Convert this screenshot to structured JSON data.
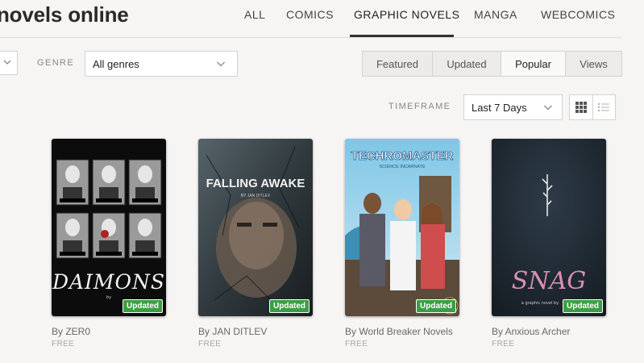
{
  "header": {
    "title": "novels online",
    "tabs": [
      {
        "label": "ALL"
      },
      {
        "label": "COMICS"
      },
      {
        "label": "GRAPHIC NOVELS"
      },
      {
        "label": "MANGA"
      },
      {
        "label": "WEBCOMICS"
      }
    ],
    "active_tab": "GRAPHIC NOVELS"
  },
  "filters": {
    "genre_label": "GENRE",
    "genre_value": "All genres",
    "sort_options": [
      {
        "label": "Featured"
      },
      {
        "label": "Updated"
      },
      {
        "label": "Popular"
      },
      {
        "label": "Views"
      }
    ],
    "active_sort": "Popular",
    "timeframe_label": "TIMEFRAME",
    "timeframe_value": "Last 7 Days",
    "view_modes": [
      "grid-icon",
      "list-icon"
    ],
    "active_view": "grid"
  },
  "books": [
    {
      "cover_title": "DAIMONS",
      "badge": "Updated",
      "author": "By ZER0",
      "price": "FREE"
    },
    {
      "cover_title": "FALLING AWAKE",
      "badge": "Updated",
      "author": "By JAN DITLEV",
      "price": "FREE"
    },
    {
      "cover_title": "TECHROMASTER",
      "badge": "Updated",
      "author": "By World Breaker Novels",
      "price": "FREE"
    },
    {
      "cover_title": "SNAG",
      "badge": "Updated",
      "author": "By Anxious Archer",
      "price": "FREE"
    }
  ],
  "colors": {
    "badge_green": "#3a9f44",
    "background": "#f6f5f4",
    "border": "#d4d2cf"
  }
}
